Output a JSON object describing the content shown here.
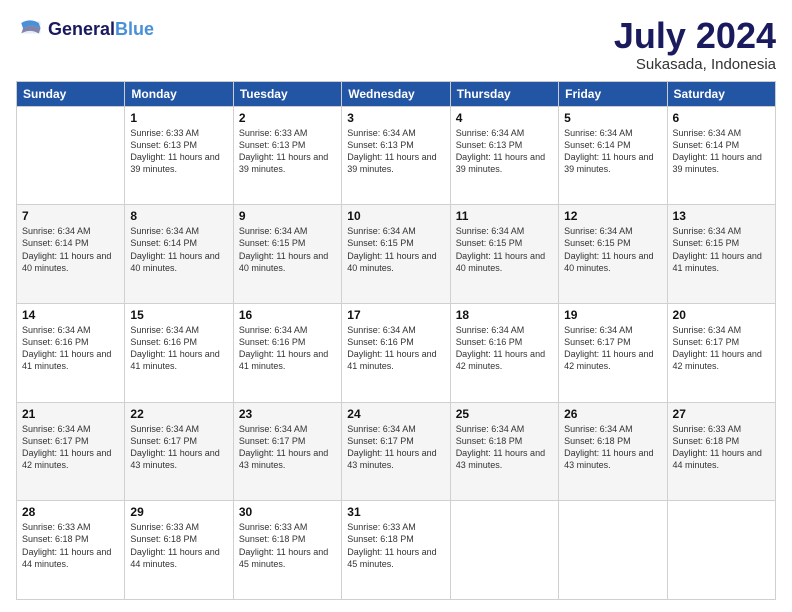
{
  "logo": {
    "line1": "General",
    "line2": "Blue"
  },
  "title": "July 2024",
  "subtitle": "Sukasada, Indonesia",
  "header_days": [
    "Sunday",
    "Monday",
    "Tuesday",
    "Wednesday",
    "Thursday",
    "Friday",
    "Saturday"
  ],
  "weeks": [
    [
      {
        "day": "",
        "sunrise": "",
        "sunset": "",
        "daylight": ""
      },
      {
        "day": "1",
        "sunrise": "Sunrise: 6:33 AM",
        "sunset": "Sunset: 6:13 PM",
        "daylight": "Daylight: 11 hours and 39 minutes."
      },
      {
        "day": "2",
        "sunrise": "Sunrise: 6:33 AM",
        "sunset": "Sunset: 6:13 PM",
        "daylight": "Daylight: 11 hours and 39 minutes."
      },
      {
        "day": "3",
        "sunrise": "Sunrise: 6:34 AM",
        "sunset": "Sunset: 6:13 PM",
        "daylight": "Daylight: 11 hours and 39 minutes."
      },
      {
        "day": "4",
        "sunrise": "Sunrise: 6:34 AM",
        "sunset": "Sunset: 6:13 PM",
        "daylight": "Daylight: 11 hours and 39 minutes."
      },
      {
        "day": "5",
        "sunrise": "Sunrise: 6:34 AM",
        "sunset": "Sunset: 6:14 PM",
        "daylight": "Daylight: 11 hours and 39 minutes."
      },
      {
        "day": "6",
        "sunrise": "Sunrise: 6:34 AM",
        "sunset": "Sunset: 6:14 PM",
        "daylight": "Daylight: 11 hours and 39 minutes."
      }
    ],
    [
      {
        "day": "7",
        "sunrise": "Sunrise: 6:34 AM",
        "sunset": "Sunset: 6:14 PM",
        "daylight": "Daylight: 11 hours and 40 minutes."
      },
      {
        "day": "8",
        "sunrise": "Sunrise: 6:34 AM",
        "sunset": "Sunset: 6:14 PM",
        "daylight": "Daylight: 11 hours and 40 minutes."
      },
      {
        "day": "9",
        "sunrise": "Sunrise: 6:34 AM",
        "sunset": "Sunset: 6:15 PM",
        "daylight": "Daylight: 11 hours and 40 minutes."
      },
      {
        "day": "10",
        "sunrise": "Sunrise: 6:34 AM",
        "sunset": "Sunset: 6:15 PM",
        "daylight": "Daylight: 11 hours and 40 minutes."
      },
      {
        "day": "11",
        "sunrise": "Sunrise: 6:34 AM",
        "sunset": "Sunset: 6:15 PM",
        "daylight": "Daylight: 11 hours and 40 minutes."
      },
      {
        "day": "12",
        "sunrise": "Sunrise: 6:34 AM",
        "sunset": "Sunset: 6:15 PM",
        "daylight": "Daylight: 11 hours and 40 minutes."
      },
      {
        "day": "13",
        "sunrise": "Sunrise: 6:34 AM",
        "sunset": "Sunset: 6:15 PM",
        "daylight": "Daylight: 11 hours and 41 minutes."
      }
    ],
    [
      {
        "day": "14",
        "sunrise": "Sunrise: 6:34 AM",
        "sunset": "Sunset: 6:16 PM",
        "daylight": "Daylight: 11 hours and 41 minutes."
      },
      {
        "day": "15",
        "sunrise": "Sunrise: 6:34 AM",
        "sunset": "Sunset: 6:16 PM",
        "daylight": "Daylight: 11 hours and 41 minutes."
      },
      {
        "day": "16",
        "sunrise": "Sunrise: 6:34 AM",
        "sunset": "Sunset: 6:16 PM",
        "daylight": "Daylight: 11 hours and 41 minutes."
      },
      {
        "day": "17",
        "sunrise": "Sunrise: 6:34 AM",
        "sunset": "Sunset: 6:16 PM",
        "daylight": "Daylight: 11 hours and 41 minutes."
      },
      {
        "day": "18",
        "sunrise": "Sunrise: 6:34 AM",
        "sunset": "Sunset: 6:16 PM",
        "daylight": "Daylight: 11 hours and 42 minutes."
      },
      {
        "day": "19",
        "sunrise": "Sunrise: 6:34 AM",
        "sunset": "Sunset: 6:17 PM",
        "daylight": "Daylight: 11 hours and 42 minutes."
      },
      {
        "day": "20",
        "sunrise": "Sunrise: 6:34 AM",
        "sunset": "Sunset: 6:17 PM",
        "daylight": "Daylight: 11 hours and 42 minutes."
      }
    ],
    [
      {
        "day": "21",
        "sunrise": "Sunrise: 6:34 AM",
        "sunset": "Sunset: 6:17 PM",
        "daylight": "Daylight: 11 hours and 42 minutes."
      },
      {
        "day": "22",
        "sunrise": "Sunrise: 6:34 AM",
        "sunset": "Sunset: 6:17 PM",
        "daylight": "Daylight: 11 hours and 43 minutes."
      },
      {
        "day": "23",
        "sunrise": "Sunrise: 6:34 AM",
        "sunset": "Sunset: 6:17 PM",
        "daylight": "Daylight: 11 hours and 43 minutes."
      },
      {
        "day": "24",
        "sunrise": "Sunrise: 6:34 AM",
        "sunset": "Sunset: 6:17 PM",
        "daylight": "Daylight: 11 hours and 43 minutes."
      },
      {
        "day": "25",
        "sunrise": "Sunrise: 6:34 AM",
        "sunset": "Sunset: 6:18 PM",
        "daylight": "Daylight: 11 hours and 43 minutes."
      },
      {
        "day": "26",
        "sunrise": "Sunrise: 6:34 AM",
        "sunset": "Sunset: 6:18 PM",
        "daylight": "Daylight: 11 hours and 43 minutes."
      },
      {
        "day": "27",
        "sunrise": "Sunrise: 6:33 AM",
        "sunset": "Sunset: 6:18 PM",
        "daylight": "Daylight: 11 hours and 44 minutes."
      }
    ],
    [
      {
        "day": "28",
        "sunrise": "Sunrise: 6:33 AM",
        "sunset": "Sunset: 6:18 PM",
        "daylight": "Daylight: 11 hours and 44 minutes."
      },
      {
        "day": "29",
        "sunrise": "Sunrise: 6:33 AM",
        "sunset": "Sunset: 6:18 PM",
        "daylight": "Daylight: 11 hours and 44 minutes."
      },
      {
        "day": "30",
        "sunrise": "Sunrise: 6:33 AM",
        "sunset": "Sunset: 6:18 PM",
        "daylight": "Daylight: 11 hours and 45 minutes."
      },
      {
        "day": "31",
        "sunrise": "Sunrise: 6:33 AM",
        "sunset": "Sunset: 6:18 PM",
        "daylight": "Daylight: 11 hours and 45 minutes."
      },
      {
        "day": "",
        "sunrise": "",
        "sunset": "",
        "daylight": ""
      },
      {
        "day": "",
        "sunrise": "",
        "sunset": "",
        "daylight": ""
      },
      {
        "day": "",
        "sunrise": "",
        "sunset": "",
        "daylight": ""
      }
    ]
  ]
}
